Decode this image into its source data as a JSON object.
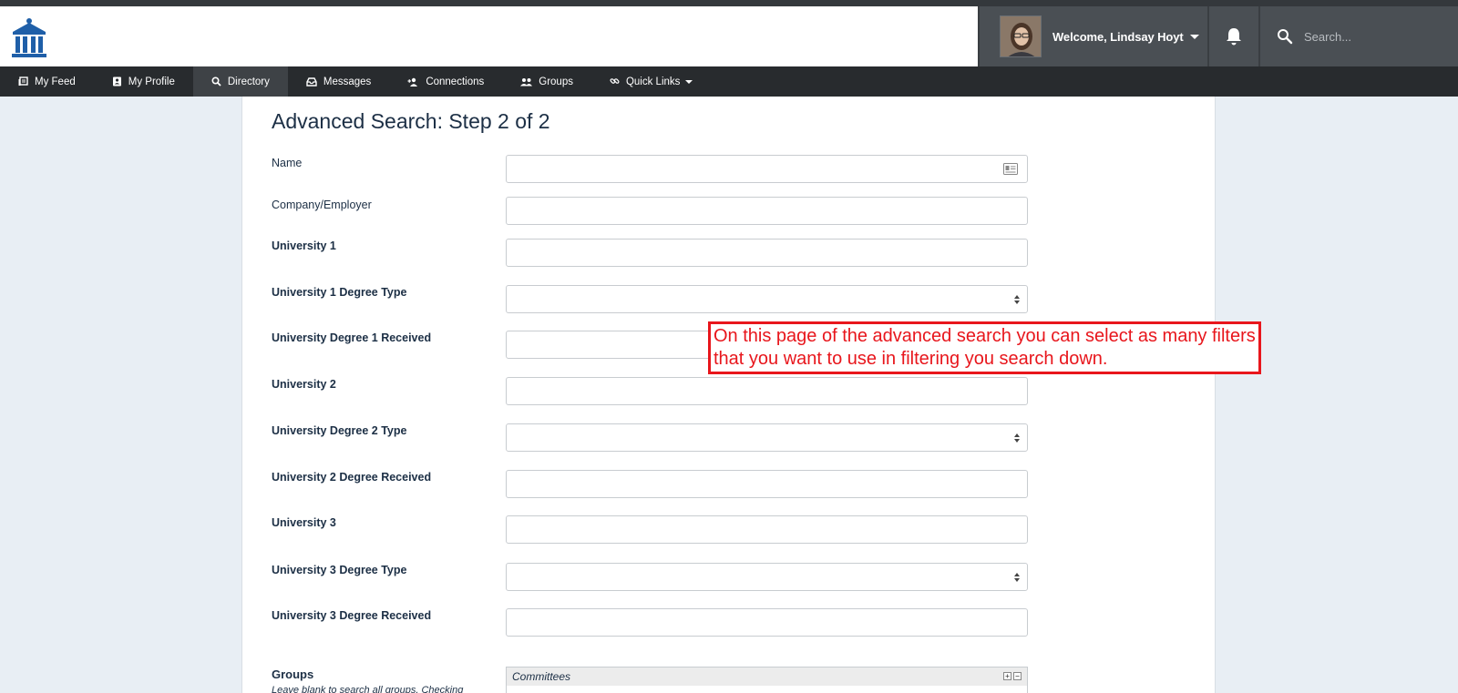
{
  "header": {
    "logo_icon": "institution-icon",
    "welcome_text": "Welcome, Lindsay Hoyt",
    "bell_icon": "bell-icon",
    "search_placeholder": "Search..."
  },
  "nav": {
    "items": [
      {
        "label": "My Feed",
        "icon": "newspaper-icon"
      },
      {
        "label": "My Profile",
        "icon": "profile-icon"
      },
      {
        "label": "Directory",
        "icon": "search-icon",
        "active": true
      },
      {
        "label": "Messages",
        "icon": "inbox-icon"
      },
      {
        "label": "Connections",
        "icon": "connections-icon"
      },
      {
        "label": "Groups",
        "icon": "groups-icon"
      },
      {
        "label": "Quick Links",
        "icon": "link-icon",
        "dropdown": true
      }
    ]
  },
  "main": {
    "title": "Advanced Search: Step 2 of 2",
    "fields": [
      {
        "label": "Name",
        "type": "text-with-card",
        "value": ""
      },
      {
        "label": "Company/Employer",
        "type": "text",
        "value": ""
      },
      {
        "label": "University 1",
        "type": "text",
        "value": ""
      },
      {
        "label": "University 1 Degree Type",
        "type": "select",
        "value": ""
      },
      {
        "label": "University Degree 1 Received",
        "type": "text",
        "value": ""
      },
      {
        "label": "University 2",
        "type": "text",
        "value": ""
      },
      {
        "label": "University Degree 2 Type",
        "type": "select",
        "value": ""
      },
      {
        "label": "University 2 Degree Received",
        "type": "text",
        "value": ""
      },
      {
        "label": "University 3",
        "type": "text",
        "value": ""
      },
      {
        "label": "University 3 Degree Type",
        "type": "select",
        "value": ""
      },
      {
        "label": "University 3 Degree Received",
        "type": "text",
        "value": ""
      }
    ],
    "groups": {
      "label": "Groups",
      "help": "Leave blank to search all groups. Checking",
      "tree_root": "Committees",
      "expand_symbol": "+",
      "collapse_symbol": "−"
    }
  },
  "annotation": {
    "text": "On this page of the advanced search you can select as many filters that you want to use in filtering you search down."
  },
  "colors": {
    "nav_bg": "#282b2e",
    "header_dark": "#4a4f54",
    "title_color": "#1c2f45",
    "logo_blue": "#1f5fa8",
    "annotation_red": "#e8161c",
    "page_bg": "#e8eef4"
  }
}
